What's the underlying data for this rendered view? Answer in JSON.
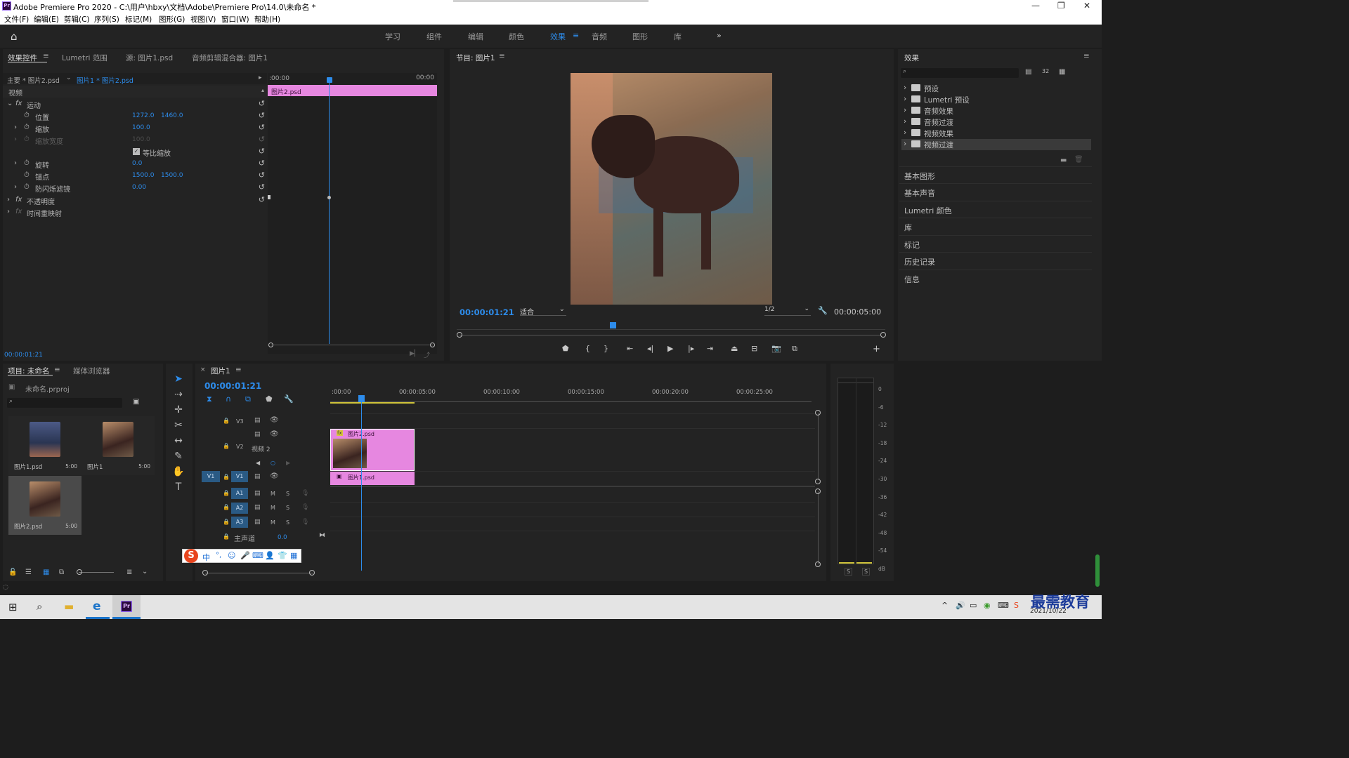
{
  "window": {
    "title": "Adobe Premiere Pro 2020 - C:\\用户\\hbxy\\文档\\Adobe\\Premiere Pro\\14.0\\未命名 *",
    "logo_text": "Pr"
  },
  "menu": [
    "文件(F)",
    "编辑(E)",
    "剪辑(C)",
    "序列(S)",
    "标记(M)",
    "图形(G)",
    "视图(V)",
    "窗口(W)",
    "帮助(H)"
  ],
  "workspaces": [
    "学习",
    "组件",
    "编辑",
    "颜色",
    "效果",
    "音频",
    "图形",
    "库"
  ],
  "workspace_active": "效果",
  "effect_controls": {
    "tabs": [
      "效果控件",
      "Lumetri 范围",
      "源: 图片1.psd",
      "音频剪辑混合器: 图片1"
    ],
    "source": "主要 * 图片2.psd",
    "clip": "图片1 * 图片2.psd",
    "time_start": ":00:00",
    "time_end": "00:00",
    "clip_bar": "图片2.psd",
    "section_video": "视频",
    "motion": "运动",
    "props": [
      {
        "name": "位置",
        "v1": "1272.0",
        "v2": "1460.0"
      },
      {
        "name": "缩放",
        "v1": "100.0",
        "v2": ""
      },
      {
        "name": "缩放宽度",
        "v1": "100.0",
        "v2": ""
      },
      {
        "name": "等比缩放",
        "v1": "",
        "v2": ""
      },
      {
        "name": "旋转",
        "v1": "0.0",
        "v2": ""
      },
      {
        "name": "锚点",
        "v1": "1500.0",
        "v2": "1500.0"
      },
      {
        "name": "防闪烁滤镜",
        "v1": "0.00",
        "v2": ""
      }
    ],
    "opacity": "不透明度",
    "timeremap": "时间重映射",
    "current_time": "00:00:01:21"
  },
  "program": {
    "title": "节目: 图片1",
    "timecode": "00:00:01:21",
    "fit": "适合",
    "quality": "1/2",
    "duration": "00:00:05:00",
    "playhead_pct": 0.355
  },
  "effects_panel": {
    "title": "效果",
    "items": [
      "预设",
      "Lumetri 预设",
      "音频效果",
      "音频过渡",
      "视频效果",
      "视频过渡"
    ],
    "sections": [
      "基本图形",
      "基本声音",
      "Lumetri 颜色",
      "库",
      "标记",
      "历史记录",
      "信息"
    ]
  },
  "project": {
    "tabs": [
      "项目: 未命名",
      "媒体浏览器"
    ],
    "file": "未命名.prproj",
    "items": [
      {
        "name": "图片1.psd",
        "dur": "5:00"
      },
      {
        "name": "图片1",
        "dur": "5:00"
      },
      {
        "name": "图片2.psd",
        "dur": "5:00"
      }
    ]
  },
  "timeline": {
    "seq": "图片1",
    "timecode": "00:00:01:21",
    "ruler": [
      ":00:00",
      "00:00:05:00",
      "00:00:10:00",
      "00:00:15:00",
      "00:00:20:00",
      "00:00:25:00"
    ],
    "tracks": {
      "v3": "V3",
      "v2": "V2",
      "v2_name": "视频 2",
      "v1": "V1",
      "a1": "A1",
      "a2": "A2",
      "a3": "A3",
      "master": "主声道",
      "master_val": "0.0",
      "m": "M",
      "s": "S"
    },
    "clip_v2": "图片2.psd",
    "clip_v1": "图片1.psd"
  },
  "meter": {
    "scale": [
      "0",
      "-6",
      "-12",
      "-18",
      "-24",
      "-30",
      "-36",
      "-42",
      "-48",
      "-54",
      "dB"
    ],
    "solo": [
      "S",
      "S"
    ]
  },
  "ime": {
    "logo": "S",
    "items": [
      "中",
      "°,",
      "☺",
      "🎤",
      "⌨",
      "👤",
      "👕",
      "▦"
    ]
  },
  "taskbar": {
    "time": "2021/10/22",
    "watermark": "最需教育"
  },
  "colors": {
    "accent": "#2d8ceb",
    "clip": "#e687e0",
    "yellow": "#cfc43a"
  }
}
